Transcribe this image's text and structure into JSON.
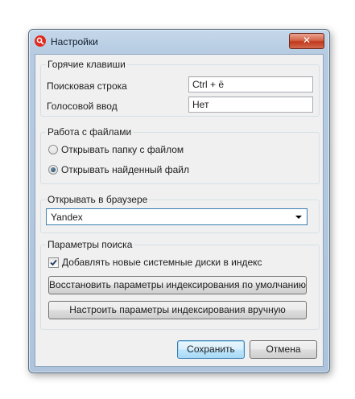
{
  "window": {
    "title": "Настройки",
    "close_glyph": "✕"
  },
  "hotkeys": {
    "legend": "Горячие клавиши",
    "search_label": "Поисковая строка",
    "search_value": "Ctrl + ё",
    "voice_label": "Голосовой ввод",
    "voice_value": "Нет"
  },
  "files": {
    "legend": "Работа с файлами",
    "options": [
      {
        "label": "Открывать папку с файлом",
        "selected": false
      },
      {
        "label": "Открывать найденный файл",
        "selected": true
      }
    ]
  },
  "browser": {
    "legend": "Открывать в браузере",
    "selected": "Yandex"
  },
  "search": {
    "legend": "Параметры поиска",
    "add_disks_label": "Добавлять новые системные диски в индекс",
    "add_disks_checked": true,
    "restore_button": "Восстановить параметры индексирования по умолчанию",
    "manual_button": "Настроить параметры индексирования вручную"
  },
  "footer": {
    "save": "Сохранить",
    "cancel": "Отмена"
  },
  "colors": {
    "accent": "#3c7fb1",
    "close": "#c0391c",
    "app_icon": "#e02a1f"
  }
}
